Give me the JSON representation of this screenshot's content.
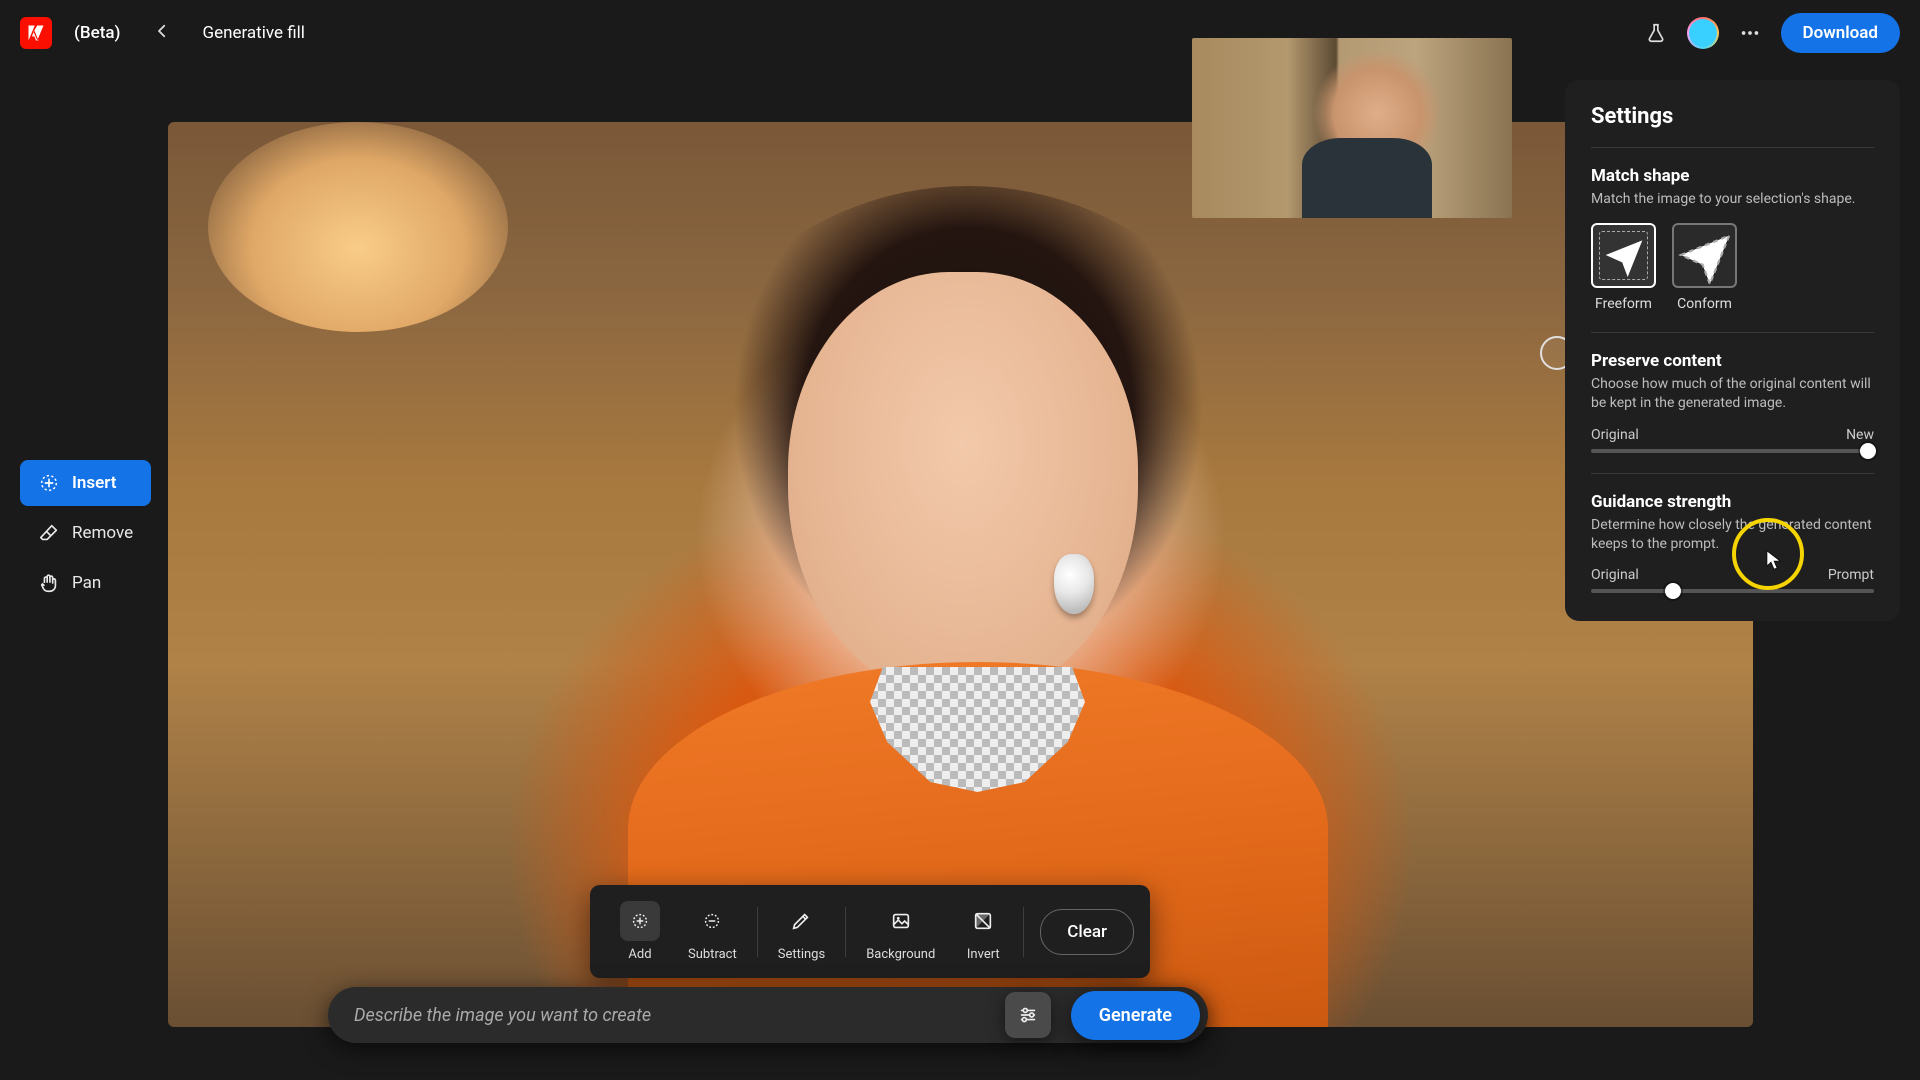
{
  "header": {
    "beta_label": "(Beta)",
    "page_title": "Generative fill",
    "download_label": "Download"
  },
  "left_tools": {
    "insert": "Insert",
    "remove": "Remove",
    "pan": "Pan"
  },
  "selection_toolbar": {
    "add": "Add",
    "subtract": "Subtract",
    "settings": "Settings",
    "background": "Background",
    "invert": "Invert",
    "clear": "Clear"
  },
  "prompt": {
    "placeholder": "Describe the image you want to create",
    "generate_label": "Generate"
  },
  "settings_panel": {
    "title": "Settings",
    "match_shape": {
      "title": "Match shape",
      "subtitle": "Match the image to your selection's shape.",
      "freeform": "Freeform",
      "conform": "Conform"
    },
    "preserve_content": {
      "title": "Preserve content",
      "subtitle": "Choose how much of the original content will be kept in the generated image.",
      "left_label": "Original",
      "right_label": "New"
    },
    "guidance_strength": {
      "title": "Guidance strength",
      "subtitle": "Determine how closely the generated content keeps to the prompt.",
      "left_label": "Original",
      "right_label": "Prompt"
    }
  }
}
